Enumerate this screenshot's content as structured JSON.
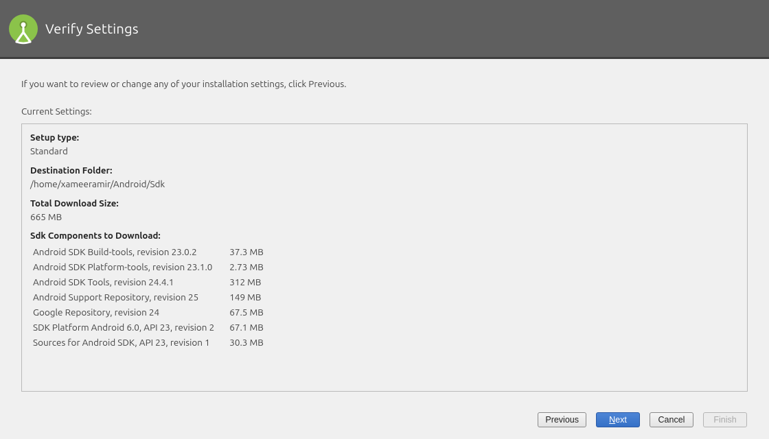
{
  "header": {
    "title": "Verify Settings"
  },
  "intro_text": "If you want to review or change any of your installation settings, click Previous.",
  "current_settings_label": "Current Settings:",
  "settings": {
    "setup_type": {
      "label": "Setup type:",
      "value": "Standard"
    },
    "destination_folder": {
      "label": "Destination Folder:",
      "value": "/home/xameeramir/Android/Sdk"
    },
    "total_download_size": {
      "label": "Total Download Size:",
      "value": "665 MB"
    },
    "components_label": "Sdk Components to Download:",
    "components": [
      {
        "name": "Android SDK Build-tools, revision 23.0.2",
        "size": "37.3 MB"
      },
      {
        "name": "Android SDK Platform-tools, revision 23.1.0",
        "size": "2.73 MB"
      },
      {
        "name": "Android SDK Tools, revision 24.4.1",
        "size": "312 MB"
      },
      {
        "name": "Android Support Repository, revision 25",
        "size": "149 MB"
      },
      {
        "name": "Google Repository, revision 24",
        "size": "67.5 MB"
      },
      {
        "name": "SDK Platform Android 6.0, API 23, revision 2",
        "size": "67.1 MB"
      },
      {
        "name": "Sources for Android SDK, API 23, revision 1",
        "size": "30.3 MB"
      }
    ]
  },
  "footer": {
    "previous": "Previous",
    "next_prefix": "N",
    "next_rest": "ext",
    "cancel": "Cancel",
    "finish": "Finish"
  }
}
